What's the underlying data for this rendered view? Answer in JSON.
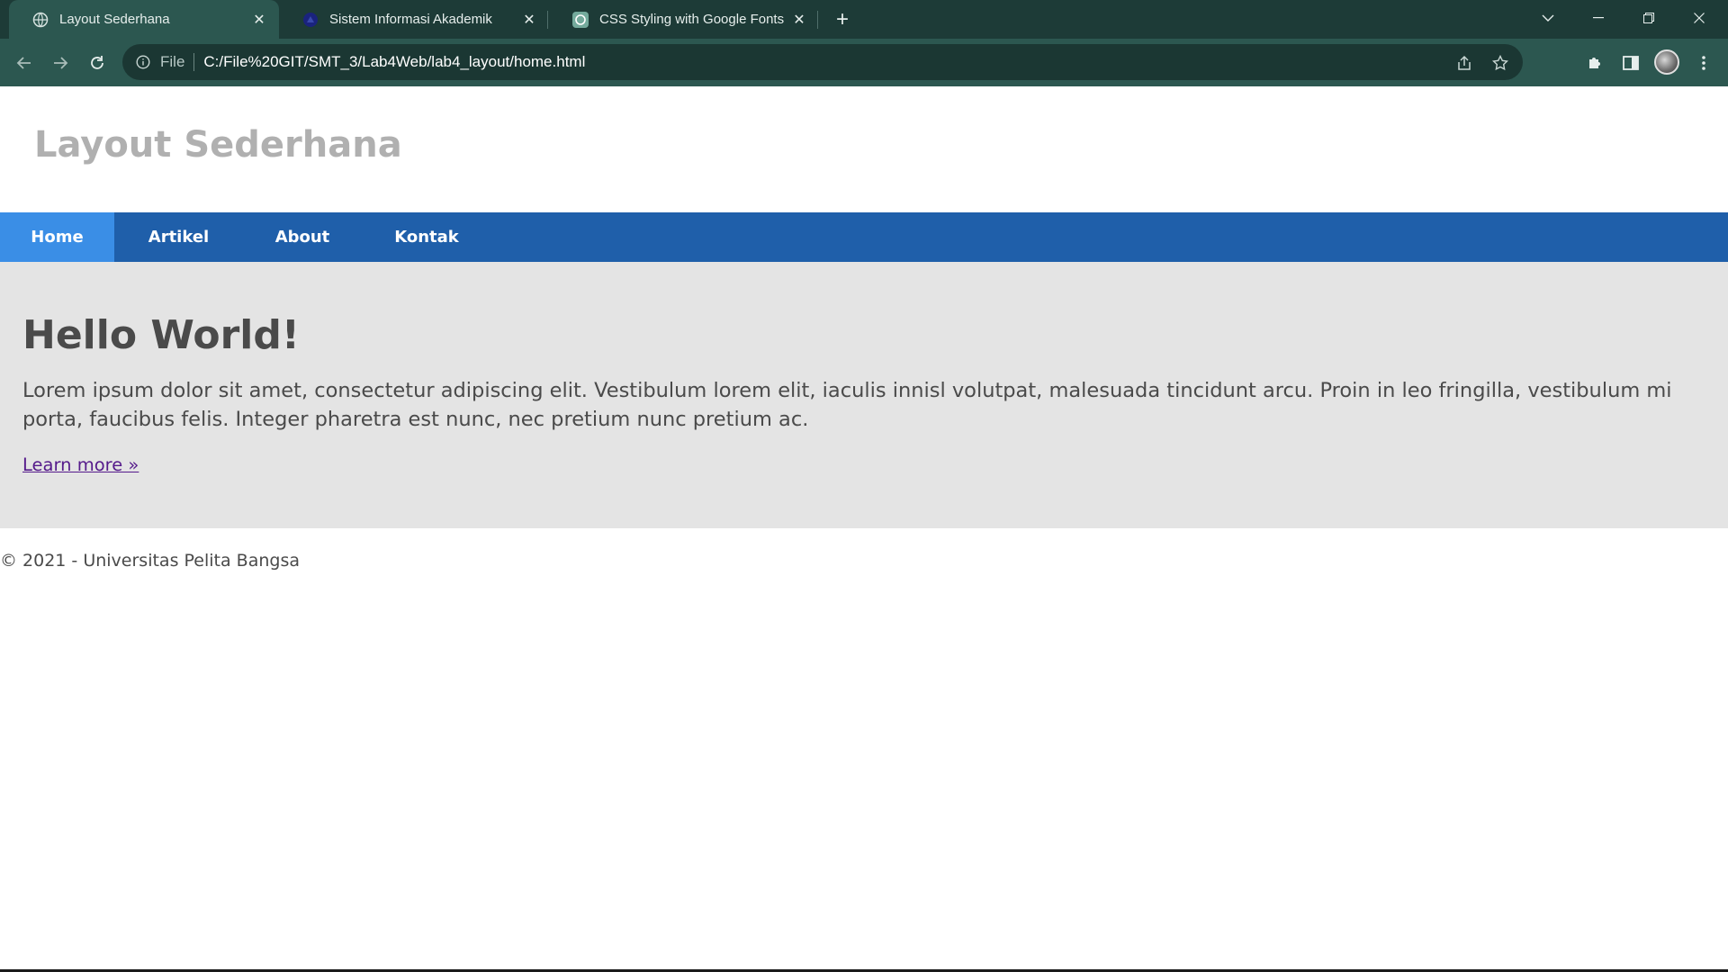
{
  "browser": {
    "tabs": [
      {
        "title": "Layout Sederhana",
        "icon": "globe-icon",
        "active": true
      },
      {
        "title": "Sistem Informasi Akademik",
        "icon": "university-logo-icon",
        "active": false
      },
      {
        "title": "CSS Styling with Google Fonts",
        "icon": "openai-logo-icon",
        "active": false
      }
    ],
    "address": {
      "scheme_label": "File",
      "url": "C:/File%20GIT/SMT_3/Lab4Web/lab4_layout/home.html"
    },
    "colors": {
      "tabstrip": "#1d3b37",
      "toolbar": "#2c5750",
      "omnibox": "#1b3733"
    }
  },
  "page": {
    "header": {
      "title": "Layout Sederhana"
    },
    "nav": {
      "items": [
        {
          "label": "Home",
          "active": true
        },
        {
          "label": "Artikel",
          "active": false
        },
        {
          "label": "About",
          "active": false
        },
        {
          "label": "Kontak",
          "active": false
        }
      ]
    },
    "hero": {
      "title": "Hello World!",
      "text": "Lorem ipsum dolor sit amet, consectetur adipiscing elit. Vestibulum lorem elit, iaculis innisl volutpat, malesuada tincidunt arcu. Proin in leo fringilla, vestibulum mi porta, faucibus felis. Integer pharetra est nunc, nec pretium nunc pretium ac.",
      "link": "Learn more »"
    },
    "footer": {
      "text": "© 2021 - Universitas Pelita Bangsa"
    },
    "colors": {
      "nav": "#1f5faa",
      "nav_active": "#3a8ee6",
      "hero_bg": "#e4e4e4",
      "title": "#b0b0b0",
      "link": "#551a8b"
    }
  }
}
